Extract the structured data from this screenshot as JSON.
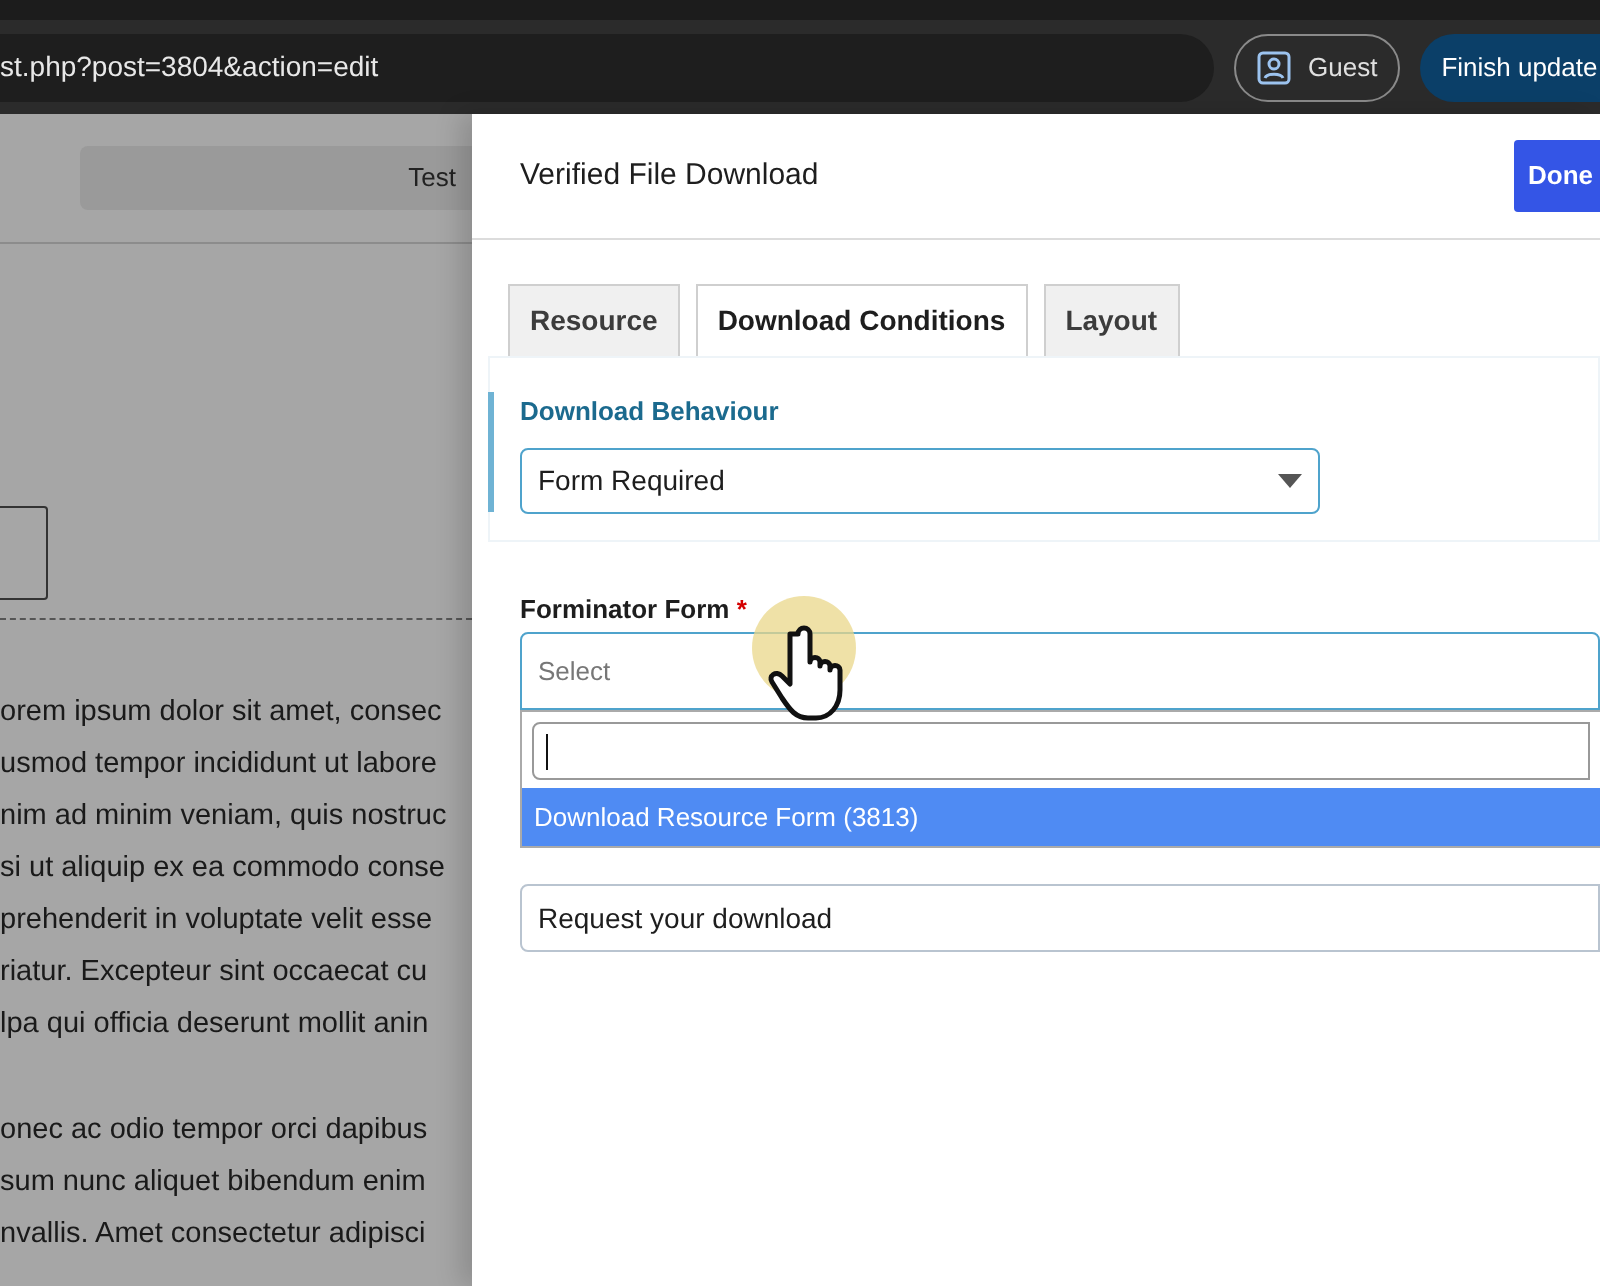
{
  "browser": {
    "url": "st.php?post=3804&action=edit",
    "profile": "Guest",
    "update_button": "Finish update"
  },
  "editor": {
    "toolbar_title": "Test",
    "paragraphs": [
      [
        "orem ipsum dolor sit amet, consec",
        "usmod tempor incididunt ut labore",
        "nim ad minim veniam, quis nostruc",
        "si ut aliquip ex ea commodo conse",
        "prehenderit in voluptate velit esse",
        "riatur. Excepteur sint occaecat cu",
        "lpa qui officia deserunt mollit anin"
      ],
      [
        "onec ac odio tempor orci dapibus",
        "sum nunc aliquet bibendum enim",
        "nvallis. Amet consectetur adipisci"
      ]
    ]
  },
  "panel": {
    "title": "Verified File Download",
    "done_button": "Done",
    "tabs": [
      {
        "label": "Resource",
        "selected": false
      },
      {
        "label": "Download Conditions",
        "selected": true
      },
      {
        "label": "Layout",
        "selected": false
      }
    ],
    "download_behaviour": {
      "label": "Download Behaviour",
      "value": "Form Required"
    },
    "forminator_form": {
      "label": "Forminator Form",
      "required_mark": "*",
      "placeholder": "Select",
      "expanded": true,
      "options": [
        {
          "label": "Download Resource Form (3813)",
          "selected": true
        }
      ]
    },
    "popup_title": {
      "value": "Request your download"
    }
  }
}
